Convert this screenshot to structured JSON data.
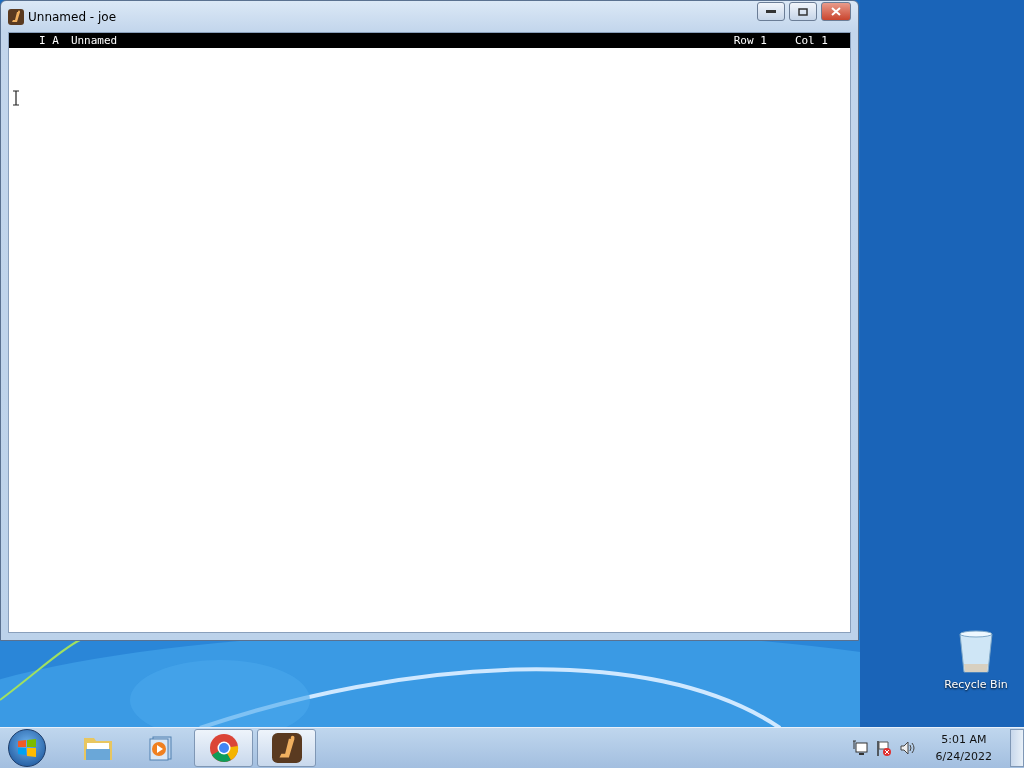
{
  "window": {
    "title": "Unnamed - joe"
  },
  "status_line": {
    "flags": "I A",
    "file": "Unnamed",
    "row": "Row 1",
    "col": "Col 1"
  },
  "desktop_icons": [
    {
      "label": "Recycle Bin"
    }
  ],
  "taskbar": {
    "apps": [
      {
        "kind": "explorer",
        "running": false
      },
      {
        "kind": "media",
        "running": false
      },
      {
        "kind": "chrome",
        "running": true
      },
      {
        "kind": "joe",
        "running": true
      }
    ]
  },
  "clock": {
    "time": "5:01 AM",
    "date": "6/24/2022"
  }
}
